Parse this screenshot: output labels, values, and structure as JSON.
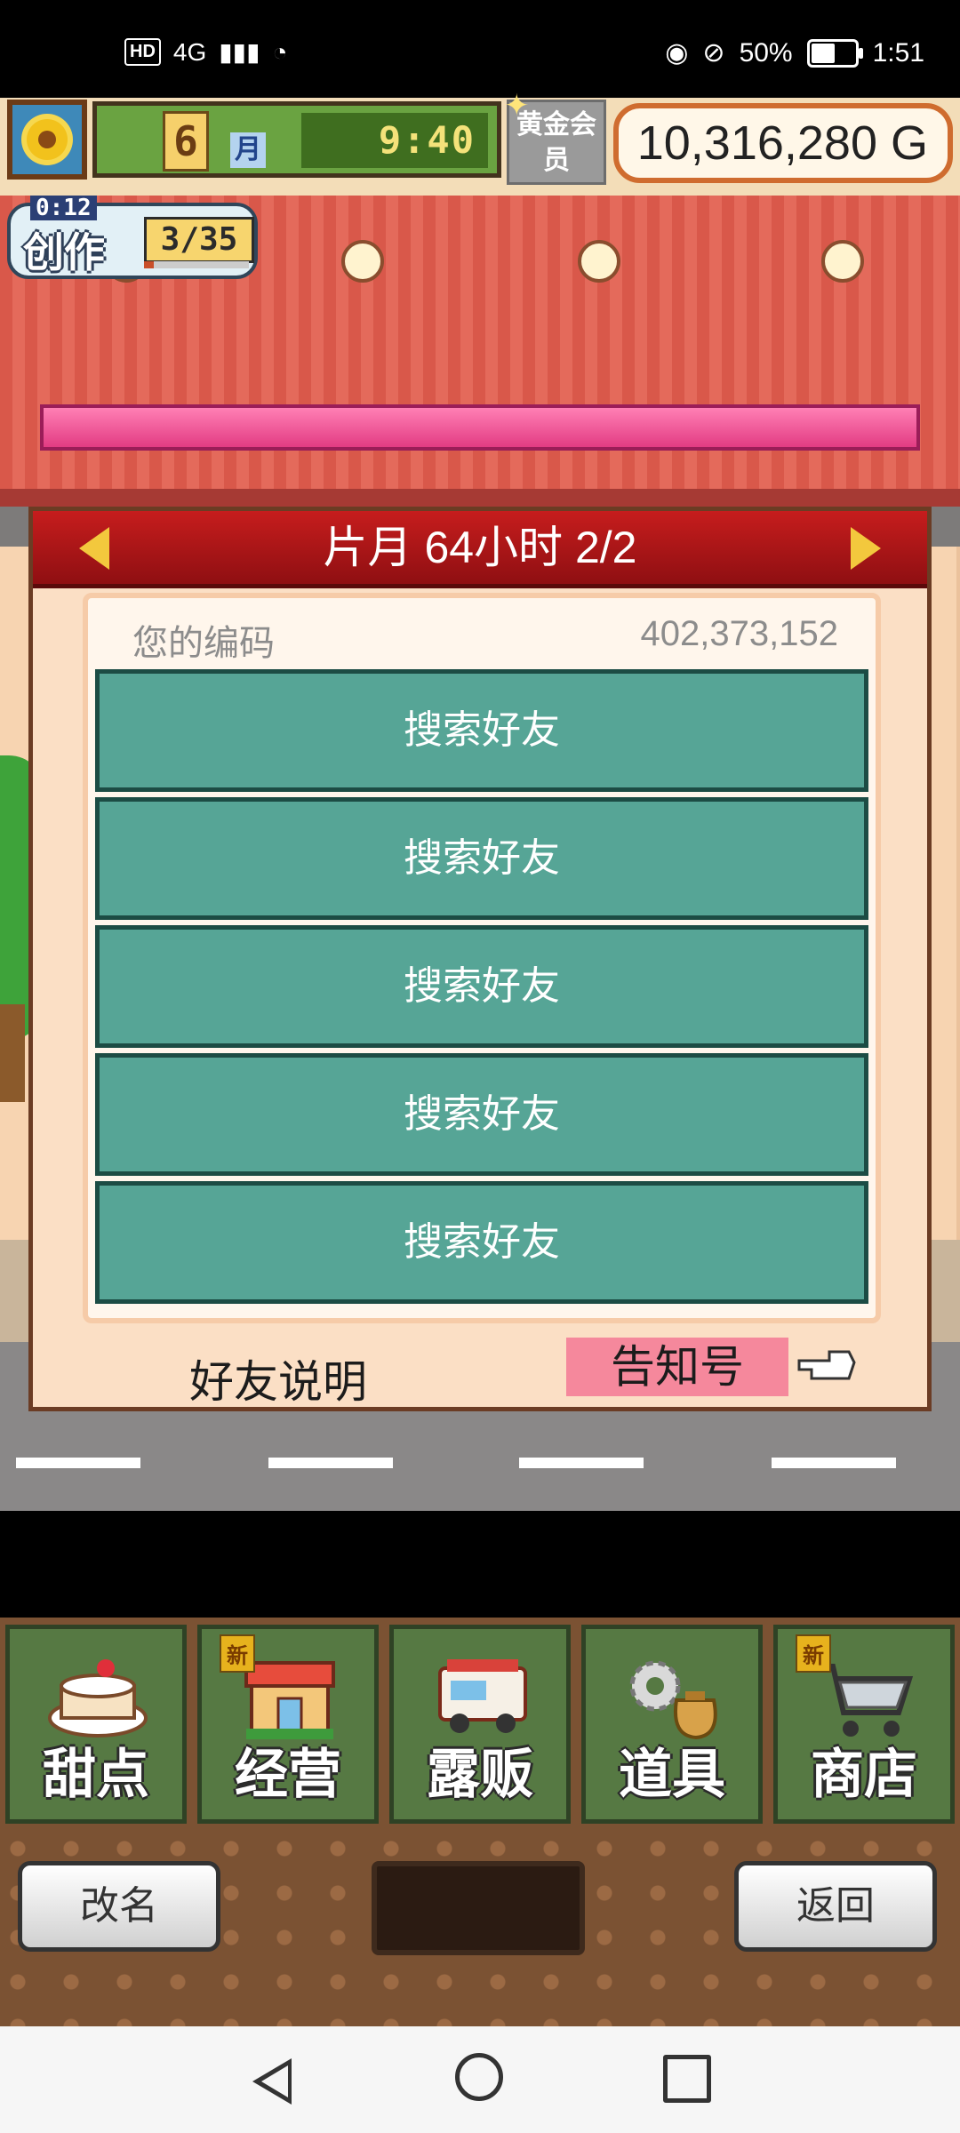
{
  "status_bar": {
    "network": "4G",
    "battery_text": "50%",
    "battery_level": 0.5,
    "time": "1:51",
    "hd_label": "HD"
  },
  "hud": {
    "month_number": "6",
    "month_label": "月",
    "time": "9:40",
    "member_badge": "黄金会员",
    "money": "10,316,280 G",
    "create_label": "创作",
    "create_timer": "0:12",
    "create_count": "3/35",
    "create_progress": 0.09
  },
  "dialog": {
    "title": "片月  64小时 2/2",
    "code_label": "您的编码",
    "code_value": "402,373,152",
    "friend_buttons": [
      "搜索好友",
      "搜索好友",
      "搜索好友",
      "搜索好友",
      "搜索好友"
    ],
    "friend_desc": "好友说明",
    "notice_button": "告知号"
  },
  "menu": {
    "items": [
      {
        "label": "甜点",
        "icon": "cake-icon",
        "badge": ""
      },
      {
        "label": "经营",
        "icon": "shop-icon",
        "badge": "新"
      },
      {
        "label": "露贩",
        "icon": "food-truck-icon",
        "badge": ""
      },
      {
        "label": "道具",
        "icon": "gear-bag-icon",
        "badge": ""
      },
      {
        "label": "商店",
        "icon": "cart-icon",
        "badge": "新"
      }
    ]
  },
  "footer": {
    "rename_label": "改名",
    "back_label": "返回"
  },
  "colors": {
    "dialog_header": "#b0181a",
    "friend_button": "#56a596",
    "notice_button": "#f5889c"
  }
}
